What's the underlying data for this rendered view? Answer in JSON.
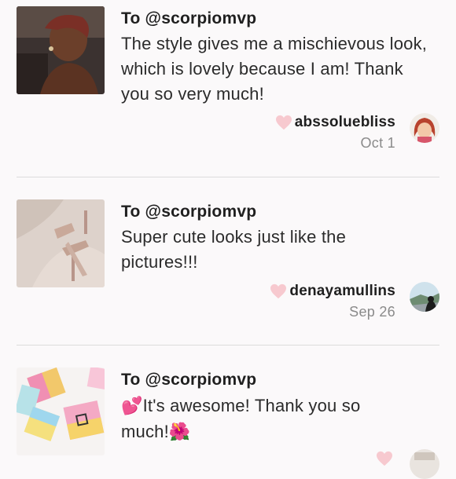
{
  "colors": {
    "background": "#fbf9fa",
    "heart": "#f7c9cf",
    "divider": "#dcdcdc",
    "date": "#8a8a8a"
  },
  "reviews": [
    {
      "to": "To @scorpiomvp",
      "comment": "The style gives me a mischievous look, which is lovely because I am! Thank you so very much!",
      "username": "abssoluebliss",
      "date": "Oct 1",
      "thumbnail_icon": "selfie-photo",
      "avatar_icon": "cartoon-avatar"
    },
    {
      "to": "To @scorpiomvp",
      "comment": "Super cute looks just like the pictures!!!",
      "username": "denayamullins",
      "date": "Sep 26",
      "thumbnail_icon": "heels-photo",
      "avatar_icon": "landscape-avatar"
    },
    {
      "to": "To @scorpiomvp",
      "comment_prefix_emoji": "💕",
      "comment": "It's awesome! Thank you so much!",
      "comment_suffix_emoji": "🌺",
      "username": "",
      "date": "",
      "thumbnail_icon": "mystery-box-photo",
      "avatar_icon": "avatar"
    }
  ]
}
